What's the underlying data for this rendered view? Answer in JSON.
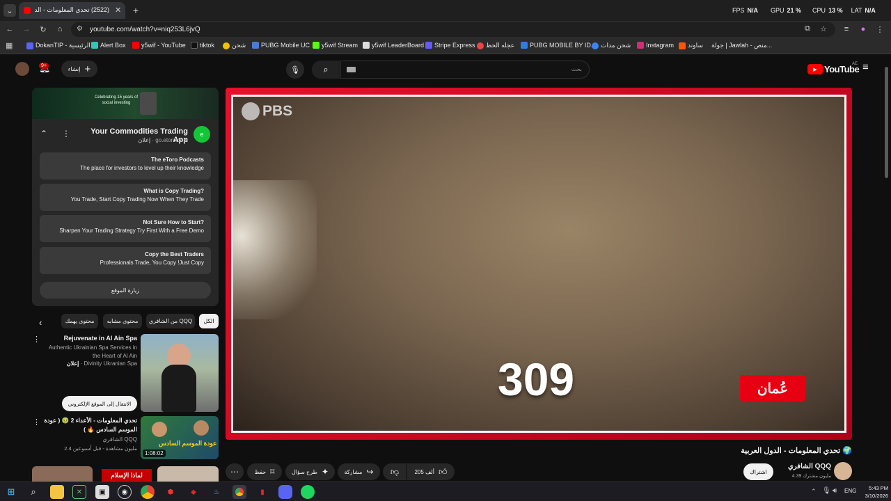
{
  "browser": {
    "tab_title": "(2522) تحدي المعلومات - الد...",
    "url": "youtube.com/watch?v=niq253L6jvQ",
    "overlay": {
      "fps_label": "FPS",
      "fps_value": "N/A",
      "gpu_label": "GPU",
      "gpu_value": "21 %",
      "cpu_label": "CPU",
      "cpu_value": "13 %",
      "lat_label": "LAT",
      "lat_value": "N/A"
    },
    "bookmarks": [
      "DokanTIP - الرئيسية",
      "Alert Box",
      "y5wif - YouTube",
      "tiktok",
      "شحن",
      "PUBG Mobile UC",
      "y5wif Stream",
      "y5wif LeaderBoard",
      "Stripe Express",
      "عجله الحظ",
      "PUBG MOBILE BY ID...",
      "شحن مدات",
      "Instagram",
      "ساوند",
      "جولة | Jawlah - منص..."
    ]
  },
  "youtube": {
    "logo": "YouTube",
    "region": "AE",
    "search_placeholder": "بحث",
    "create_label": "إنشاء",
    "notif_count": "9+"
  },
  "ad": {
    "banner_text": "Celebrating 15 years of social investing",
    "title": "Your Commodities Trading App",
    "sponsor_label": "إعلان",
    "domain": "go.etoro.com",
    "rows": [
      {
        "title": "The eToro Podcasts",
        "desc": "The place for investors to level up their knowledge"
      },
      {
        "title": "What is Copy Trading?",
        "desc": "You Trade, Start Copy Trading Now When They Trade"
      },
      {
        "title": "Not Sure How to Start?",
        "desc": "Sharpen Your Trading Strategy Try First With a Free Demo"
      },
      {
        "title": "Copy the Best Traders",
        "desc": "Professionals Trade, You Copy !Just Copy"
      }
    ],
    "visit_label": "زيارة الموقع"
  },
  "chips": [
    "الكل",
    "من الشافري QQQ",
    "محتوى مشابه",
    "محتوى يهمك"
  ],
  "recommendations": [
    {
      "title": "Rejuvenate in Al Ain Spa",
      "desc": "Authentic Ukrainian Spa Services in the Heart of Al Ain",
      "channel": "Divinity Ukranian Spa",
      "badge": "إعلان",
      "cta": "الانتقال إلى الموقع الإلكتروني"
    },
    {
      "title": "تحدي المعلومات - الأعداء 2 🤢 ( عودة الموسم السادس 🔥 )",
      "channel": "الشافري QQQ",
      "meta": "2.4 مليون مشاهدة - قبل أسبوعين",
      "duration": "1:08:02",
      "thumb_text": "عودة الموسم السادس"
    },
    {
      "title": "لماذا الإسلام",
      "channel": "",
      "meta": ""
    }
  ],
  "player": {
    "watermark": "PBS",
    "counter": "309",
    "country_tag": "عُمان"
  },
  "video": {
    "title": "تحدي المعلومات - الدول العربية 🌍",
    "channel": "الشافري QQQ",
    "subs": "4.39 مليون مشترك",
    "subscribe_label": "اشتراك",
    "likes": "205 ألف",
    "share_label": "مشاركة",
    "ask_label": "طرح سؤال",
    "save_label": "حفظ"
  },
  "taskbar": {
    "time": "5:43 PM",
    "date": "3/10/2026",
    "lang": "ENG"
  }
}
